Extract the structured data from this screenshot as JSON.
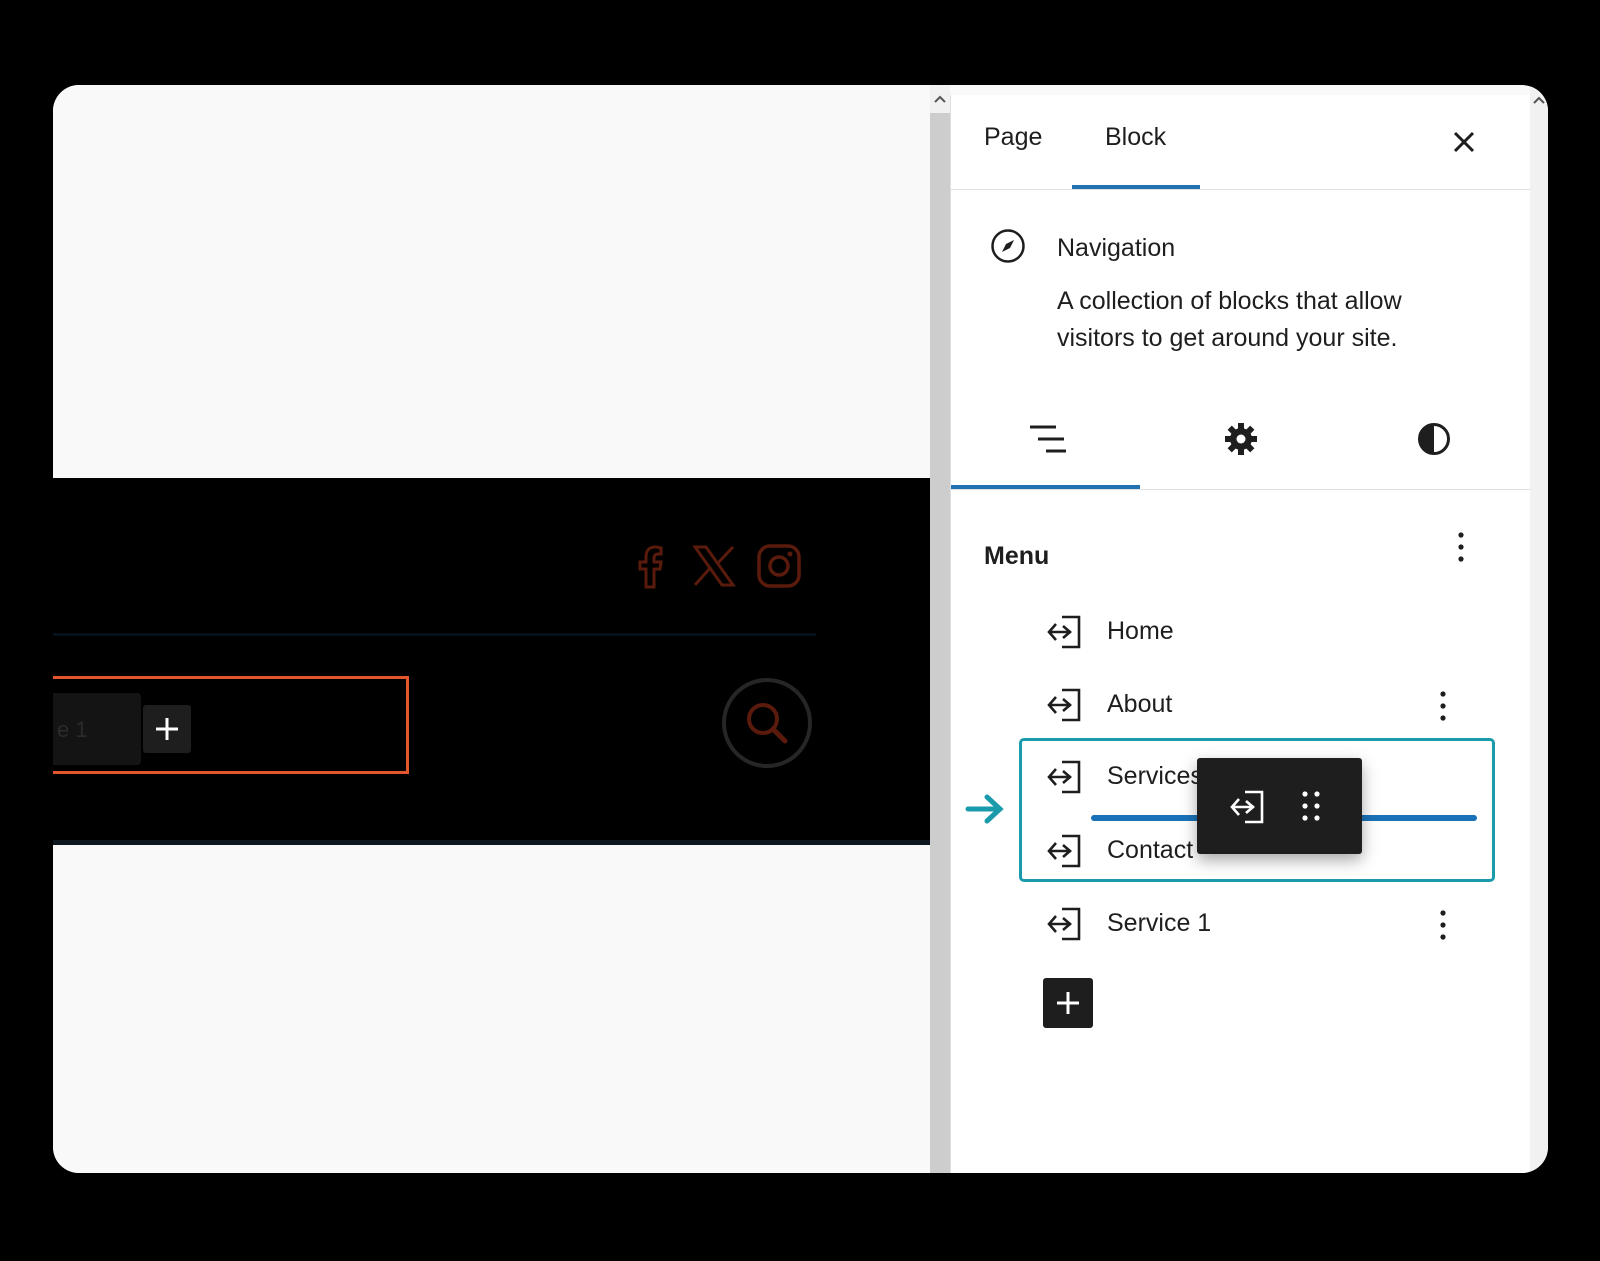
{
  "sidebar": {
    "tabs": [
      {
        "label": "Page",
        "active": false
      },
      {
        "label": "Block",
        "active": true
      }
    ],
    "close_icon": "close-icon",
    "block": {
      "icon": "compass-icon",
      "title": "Navigation",
      "description": "A collection of blocks that allow visitors to get around your site."
    },
    "subtabs": [
      {
        "icon": "list-view-icon",
        "active": true
      },
      {
        "icon": "gear-icon",
        "active": false
      },
      {
        "icon": "contrast-icon",
        "active": false
      }
    ],
    "menu": {
      "title": "Menu",
      "items": [
        {
          "label": "Home",
          "icon": "login-icon"
        },
        {
          "label": "About",
          "icon": "login-icon"
        },
        {
          "label": "Services",
          "icon": "login-icon"
        },
        {
          "label": "Contact",
          "icon": "login-icon"
        },
        {
          "label": "Service 1",
          "icon": "login-icon"
        }
      ]
    }
  },
  "colors": {
    "accent": "#2271b1",
    "selection": "#1a9bab",
    "nav_outline": "#e4572e",
    "social_icons": "#5a1a0c"
  }
}
